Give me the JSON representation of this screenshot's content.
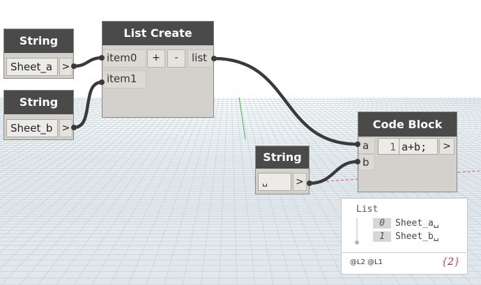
{
  "nodes": {
    "string1": {
      "title": "String",
      "value": "Sheet_a",
      "output": ">"
    },
    "string2": {
      "title": "String",
      "value": "Sheet_b",
      "output": ">"
    },
    "string3": {
      "title": "String",
      "value": "␣",
      "output": ">"
    },
    "list_create": {
      "title": "List Create",
      "inputs": [
        "item0",
        "item1"
      ],
      "add": "+",
      "remove": "-",
      "output": "list"
    },
    "code_block": {
      "title": "Code Block",
      "inputs": [
        "a",
        "b"
      ],
      "line_number": "1",
      "code": "a+b;",
      "output": ">"
    }
  },
  "watch": {
    "title": "List",
    "items": [
      {
        "index": "0",
        "value": "Sheet_a␣"
      },
      {
        "index": "1",
        "value": "Sheet_b␣"
      }
    ],
    "levels": "@L2 @L1",
    "count_open": "{",
    "count": "2",
    "count_close": "}"
  },
  "colors": {
    "node_header": "#4a4a4a",
    "node_body": "#d4d1cc",
    "wire": "#3a3a3a",
    "grid": "#b9cad2",
    "axis_red": "#e05555",
    "axis_green": "#4caf50"
  }
}
